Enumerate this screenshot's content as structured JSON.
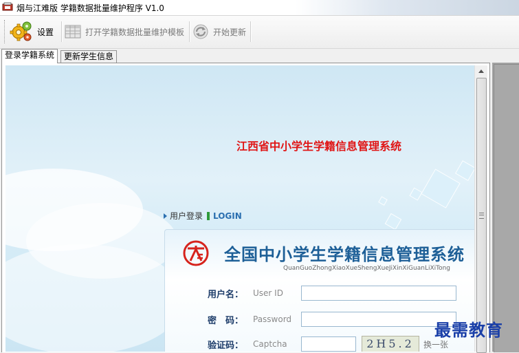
{
  "window": {
    "title": "烟与江难版 学籍数据批量维护程序 V1.0"
  },
  "toolbar": {
    "settings_label": "设置",
    "open_template_label": "打开学籍数据批量维护模板",
    "start_update_label": "开始更新"
  },
  "tabs": [
    {
      "label": "登录学籍系统",
      "active": true
    },
    {
      "label": "更新学生信息",
      "active": false
    }
  ],
  "webpage": {
    "system_title": "江西省中小学生学籍信息管理系统",
    "login_header_cn": "用户登录",
    "login_header_en": "LOGIN",
    "panel_title": "全国中小学生学籍信息管理系统",
    "panel_pinyin": "QuanGuoZhongXiaoXueShengXueJiXinXiGuanLiXiTong",
    "fields": {
      "username": {
        "label": "用户名：",
        "hint": "User ID",
        "value": ""
      },
      "password": {
        "label": "密　码：",
        "hint": "Password",
        "value": ""
      },
      "captcha": {
        "label": "验证码：",
        "hint": "Captcha",
        "value": "",
        "image_text": "2H5.2",
        "refresh_label": "换一张"
      }
    }
  },
  "watermark": "最需教育",
  "colors": {
    "system_title": "#e01515",
    "panel_title": "#1d5f97",
    "login_bar": "#2e9a3a",
    "watermark": "#1a3fa8"
  }
}
